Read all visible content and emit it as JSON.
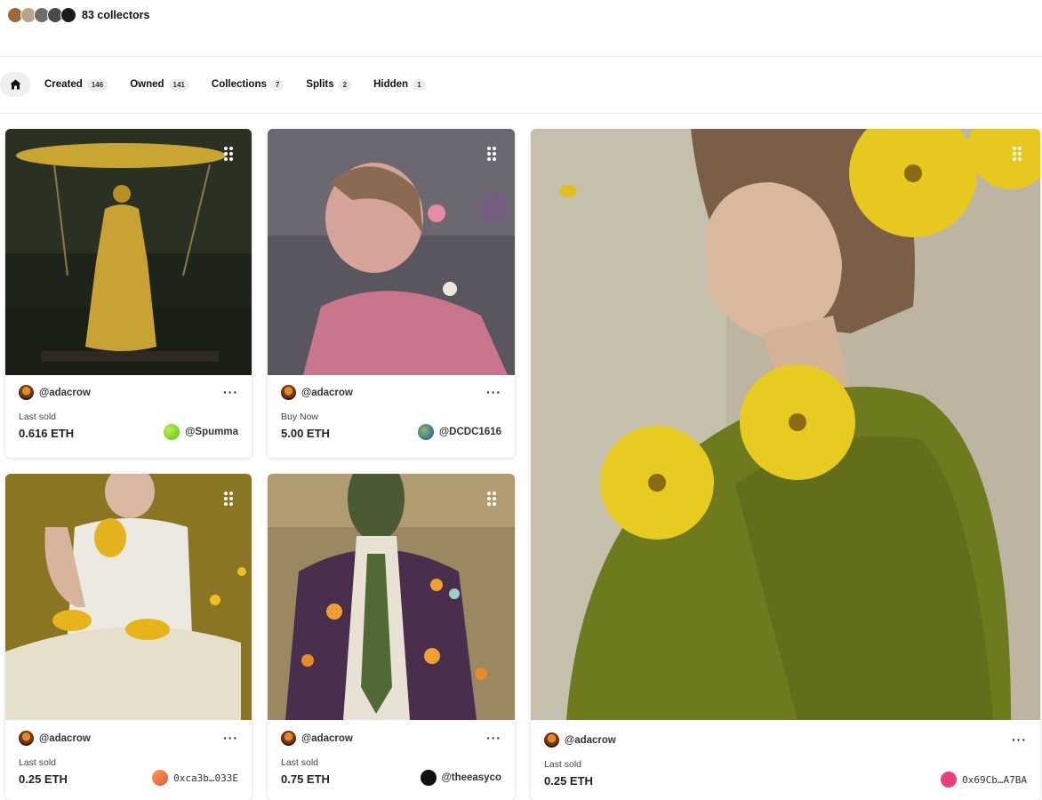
{
  "collectors": {
    "count_label": "83 collectors",
    "avatar_colors": [
      "#9c6a3a",
      "#b7a48c",
      "#6d6d6d",
      "#4a4a4a",
      "#1a1a1a"
    ]
  },
  "tabs": {
    "home_icon": "home-icon",
    "items": [
      {
        "label": "Created",
        "count": "146"
      },
      {
        "label": "Owned",
        "count": "141"
      },
      {
        "label": "Collections",
        "count": "7"
      },
      {
        "label": "Splits",
        "count": "2"
      },
      {
        "label": "Hidden",
        "count": "1"
      }
    ]
  },
  "cards": [
    {
      "creator": "@adacrow",
      "status": "Last sold",
      "price": "0.616 ETH",
      "owner": "@Spumma",
      "owner_color": "#7ed321",
      "artwork": "yellow-dress-swing"
    },
    {
      "creator": "@adacrow",
      "status": "Buy Now",
      "price": "5.00 ETH",
      "owner": "@DCDC1616",
      "owner_color": "#4a7fa8",
      "artwork": "pink-woman-flowers"
    },
    {
      "creator": "@adacrow",
      "status": "Last sold",
      "price": "0.25 ETH",
      "owner": "0xca3b…033E",
      "owner_color": "#f08a3c",
      "artwork": "woman-yarn-table"
    },
    {
      "creator": "@adacrow",
      "status": "Last sold",
      "price": "0.75 ETH",
      "owner": "@theeasyco",
      "owner_color": "#111111",
      "artwork": "suit-flowers"
    },
    {
      "creator": "@adacrow",
      "status": "Last sold",
      "price": "0.25 ETH",
      "owner": "0x69Cb…A7BA",
      "owner_color": "#e83e7c",
      "artwork": "woman-green-sweater-yellow-flowers"
    }
  ],
  "more_label": "···"
}
